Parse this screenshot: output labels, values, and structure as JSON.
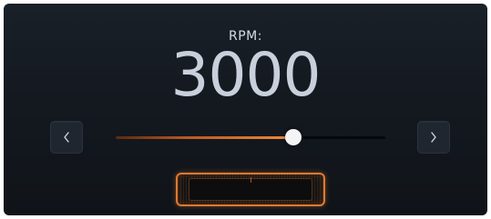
{
  "rpm": {
    "label": "RPM:",
    "value": "3000",
    "slider_fraction": 0.66
  },
  "nav": {
    "prev_icon": "chevron-left-icon",
    "next_icon": "chevron-right-icon"
  },
  "colors": {
    "accent": "#e0782e",
    "background": "#141920",
    "text": "#c9cfdb"
  }
}
